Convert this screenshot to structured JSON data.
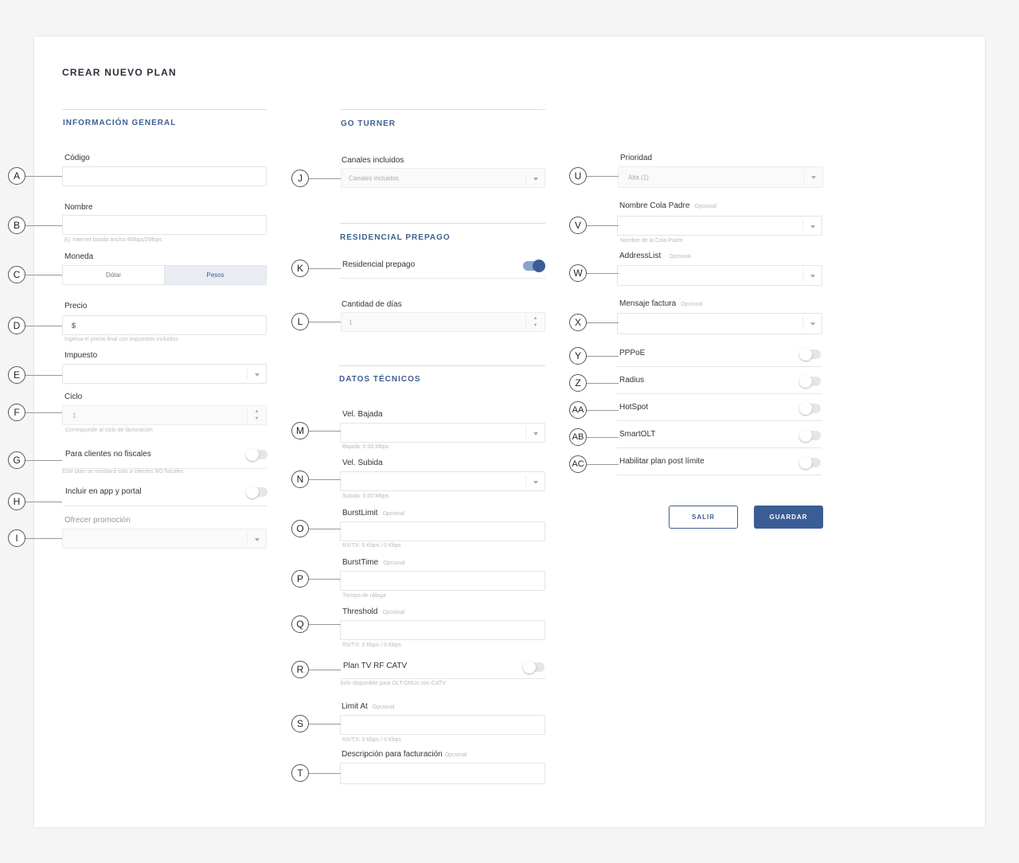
{
  "page": {
    "title": "CREAR NUEVO PLAN"
  },
  "general": {
    "section_title": "INFORMACIÓN GENERAL",
    "codigo_label": "Código",
    "nombre_label": "Nombre",
    "nombre_hint": "Ej: Internet banda ancha 4Mbps/2Mbps",
    "moneda_label": "Moneda",
    "moneda_options": [
      "Dólar",
      "Pesos"
    ],
    "moneda_selected": "Pesos",
    "precio_label": "Precio",
    "precio_prefix": "$",
    "precio_hint": "Ingresa el precio final con impuestos incluidos",
    "impuesto_label": "Impuesto",
    "ciclo_label": "Ciclo",
    "ciclo_value": "1",
    "ciclo_hint": "Corresponde al ciclo de facturación",
    "no_fiscales_label": "Para clientes no fiscales",
    "no_fiscales_hint": "Este plan se mostrará solo a clientes NO fiscales",
    "incluir_app_label": "Incluir en app y portal",
    "promocion_label": "Ofrecer promoción"
  },
  "goturner": {
    "section_title": "GO TURNER",
    "canales_label": "Canales incluidos",
    "canales_placeholder": "Canales incluidos"
  },
  "prepago": {
    "section_title": "RESIDENCIAL PREPAGO",
    "toggle_label": "Residencial prepago",
    "toggle_on": true,
    "dias_label": "Cantidad de días",
    "dias_value": "1"
  },
  "tecnicos": {
    "section_title": "DATOS TÉCNICOS",
    "bajada_label": "Vel. Bajada",
    "bajada_hint": "Bajada: 0.00 Mbps",
    "subida_label": "Vel. Subida",
    "subida_hint": "Subida: 0.00 Mbps",
    "burstlimit_label": "BurstLimit",
    "burstlimit_hint": "RX/TX: 0 Kbps / 0 Kbps",
    "bursttime_label": "BurstTime",
    "bursttime_hint": "Tiempo de ráfaga",
    "threshold_label": "Threshold",
    "threshold_hint": "RX/TX: 0 Kbps / 0 Kbps",
    "catv_label": "Plan TV RF CATV",
    "catv_hint": "Solo disponible para OLT-ONUs con CATV",
    "limitat_label": "Limit At",
    "limitat_hint": "RX/TX: 0 Kbps / 0 Kbps",
    "descripcion_label": "Descripción para facturación",
    "optional": "Opcional"
  },
  "avanzado": {
    "prioridad_label": "Prioridad",
    "prioridad_value": "Alta (1)",
    "cola_label": "Nombre Cola Padre",
    "cola_hint": "Nombre de la Cola Padre",
    "addresslist_label": "AddressList",
    "mensaje_label": "Mensaje factura",
    "pppoe_label": "PPPoE",
    "radius_label": "Radius",
    "hotspot_label": "HotSpot",
    "smartolt_label": "SmartOLT",
    "postlimite_label": "Habilitar plan post límite"
  },
  "actions": {
    "salir": "SALIR",
    "guardar": "GUARDAR"
  },
  "markers": {
    "a": "A",
    "b": "B",
    "c": "C",
    "d": "D",
    "e": "E",
    "f": "F",
    "g": "G",
    "h": "H",
    "i": "I",
    "j": "J",
    "k": "K",
    "l": "L",
    "m": "M",
    "n": "N",
    "o": "O",
    "p": "P",
    "q": "Q",
    "r": "R",
    "s": "S",
    "t": "T",
    "u": "U",
    "v": "V",
    "w": "W",
    "x": "X",
    "y": "Y",
    "z": "Z",
    "aa": "AA",
    "ab": "AB",
    "ac": "AC"
  }
}
